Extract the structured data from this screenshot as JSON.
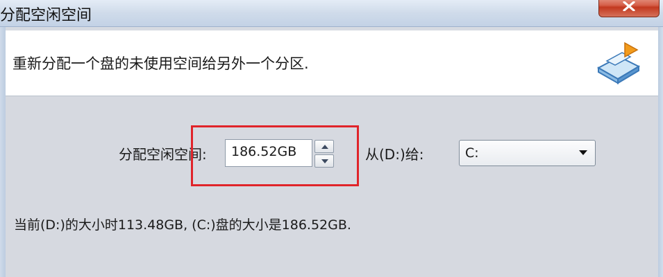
{
  "window": {
    "title": "分配空闲空间"
  },
  "header": {
    "description": "重新分配一个盘的未使用空间给另外一个分区."
  },
  "form": {
    "alloc_label": "分配空闲空间:",
    "alloc_value": "186.52GB",
    "from_label": "从(D:)给:",
    "target_value": "C:"
  },
  "status": {
    "text": "当前(D:)的大小时113.48GB, (C:)盘的大小是186.52GB."
  },
  "icons": {
    "close": "close-icon",
    "header": "partition-drive-icon",
    "spin_up": "triangle-up-icon",
    "spin_down": "triangle-down-icon",
    "dropdown": "chevron-down-icon"
  },
  "colors": {
    "highlight": "#e0242a",
    "close_button": "#c2391f"
  }
}
